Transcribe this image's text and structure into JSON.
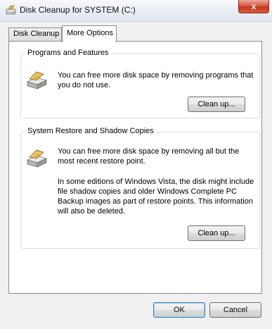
{
  "window": {
    "title": "Disk Cleanup for SYSTEM (C:)",
    "close_glyph": "x"
  },
  "tabs": [
    {
      "label": "Disk Cleanup",
      "active": false
    },
    {
      "label": "More Options",
      "active": true
    }
  ],
  "programs": {
    "group_label": "Programs and Features",
    "line1": "You can free more disk space by removing programs that",
    "line2": "you do not use.",
    "button_label": "Clean up...",
    "icon": "programs-drive-icon"
  },
  "restore": {
    "group_label": "System Restore and Shadow Copies",
    "line1": "You can free more disk space by removing all but the",
    "line2": "most recent restore point.",
    "para2_line1": "In some editions of Windows Vista, the disk might include",
    "para2_line2": "file shadow copies and older Windows Complete PC",
    "para2_line3": "Backup images as part of restore points. This information",
    "para2_line4": "will also be deleted.",
    "button_label": "Clean up...",
    "icon": "restore-drive-icon"
  },
  "footer": {
    "ok_label": "OK",
    "cancel_label": "Cancel"
  },
  "colors": {
    "dialog_bg": "#f0f0f0",
    "panel_bg": "#ffffff",
    "close_button": "#c4381f"
  }
}
